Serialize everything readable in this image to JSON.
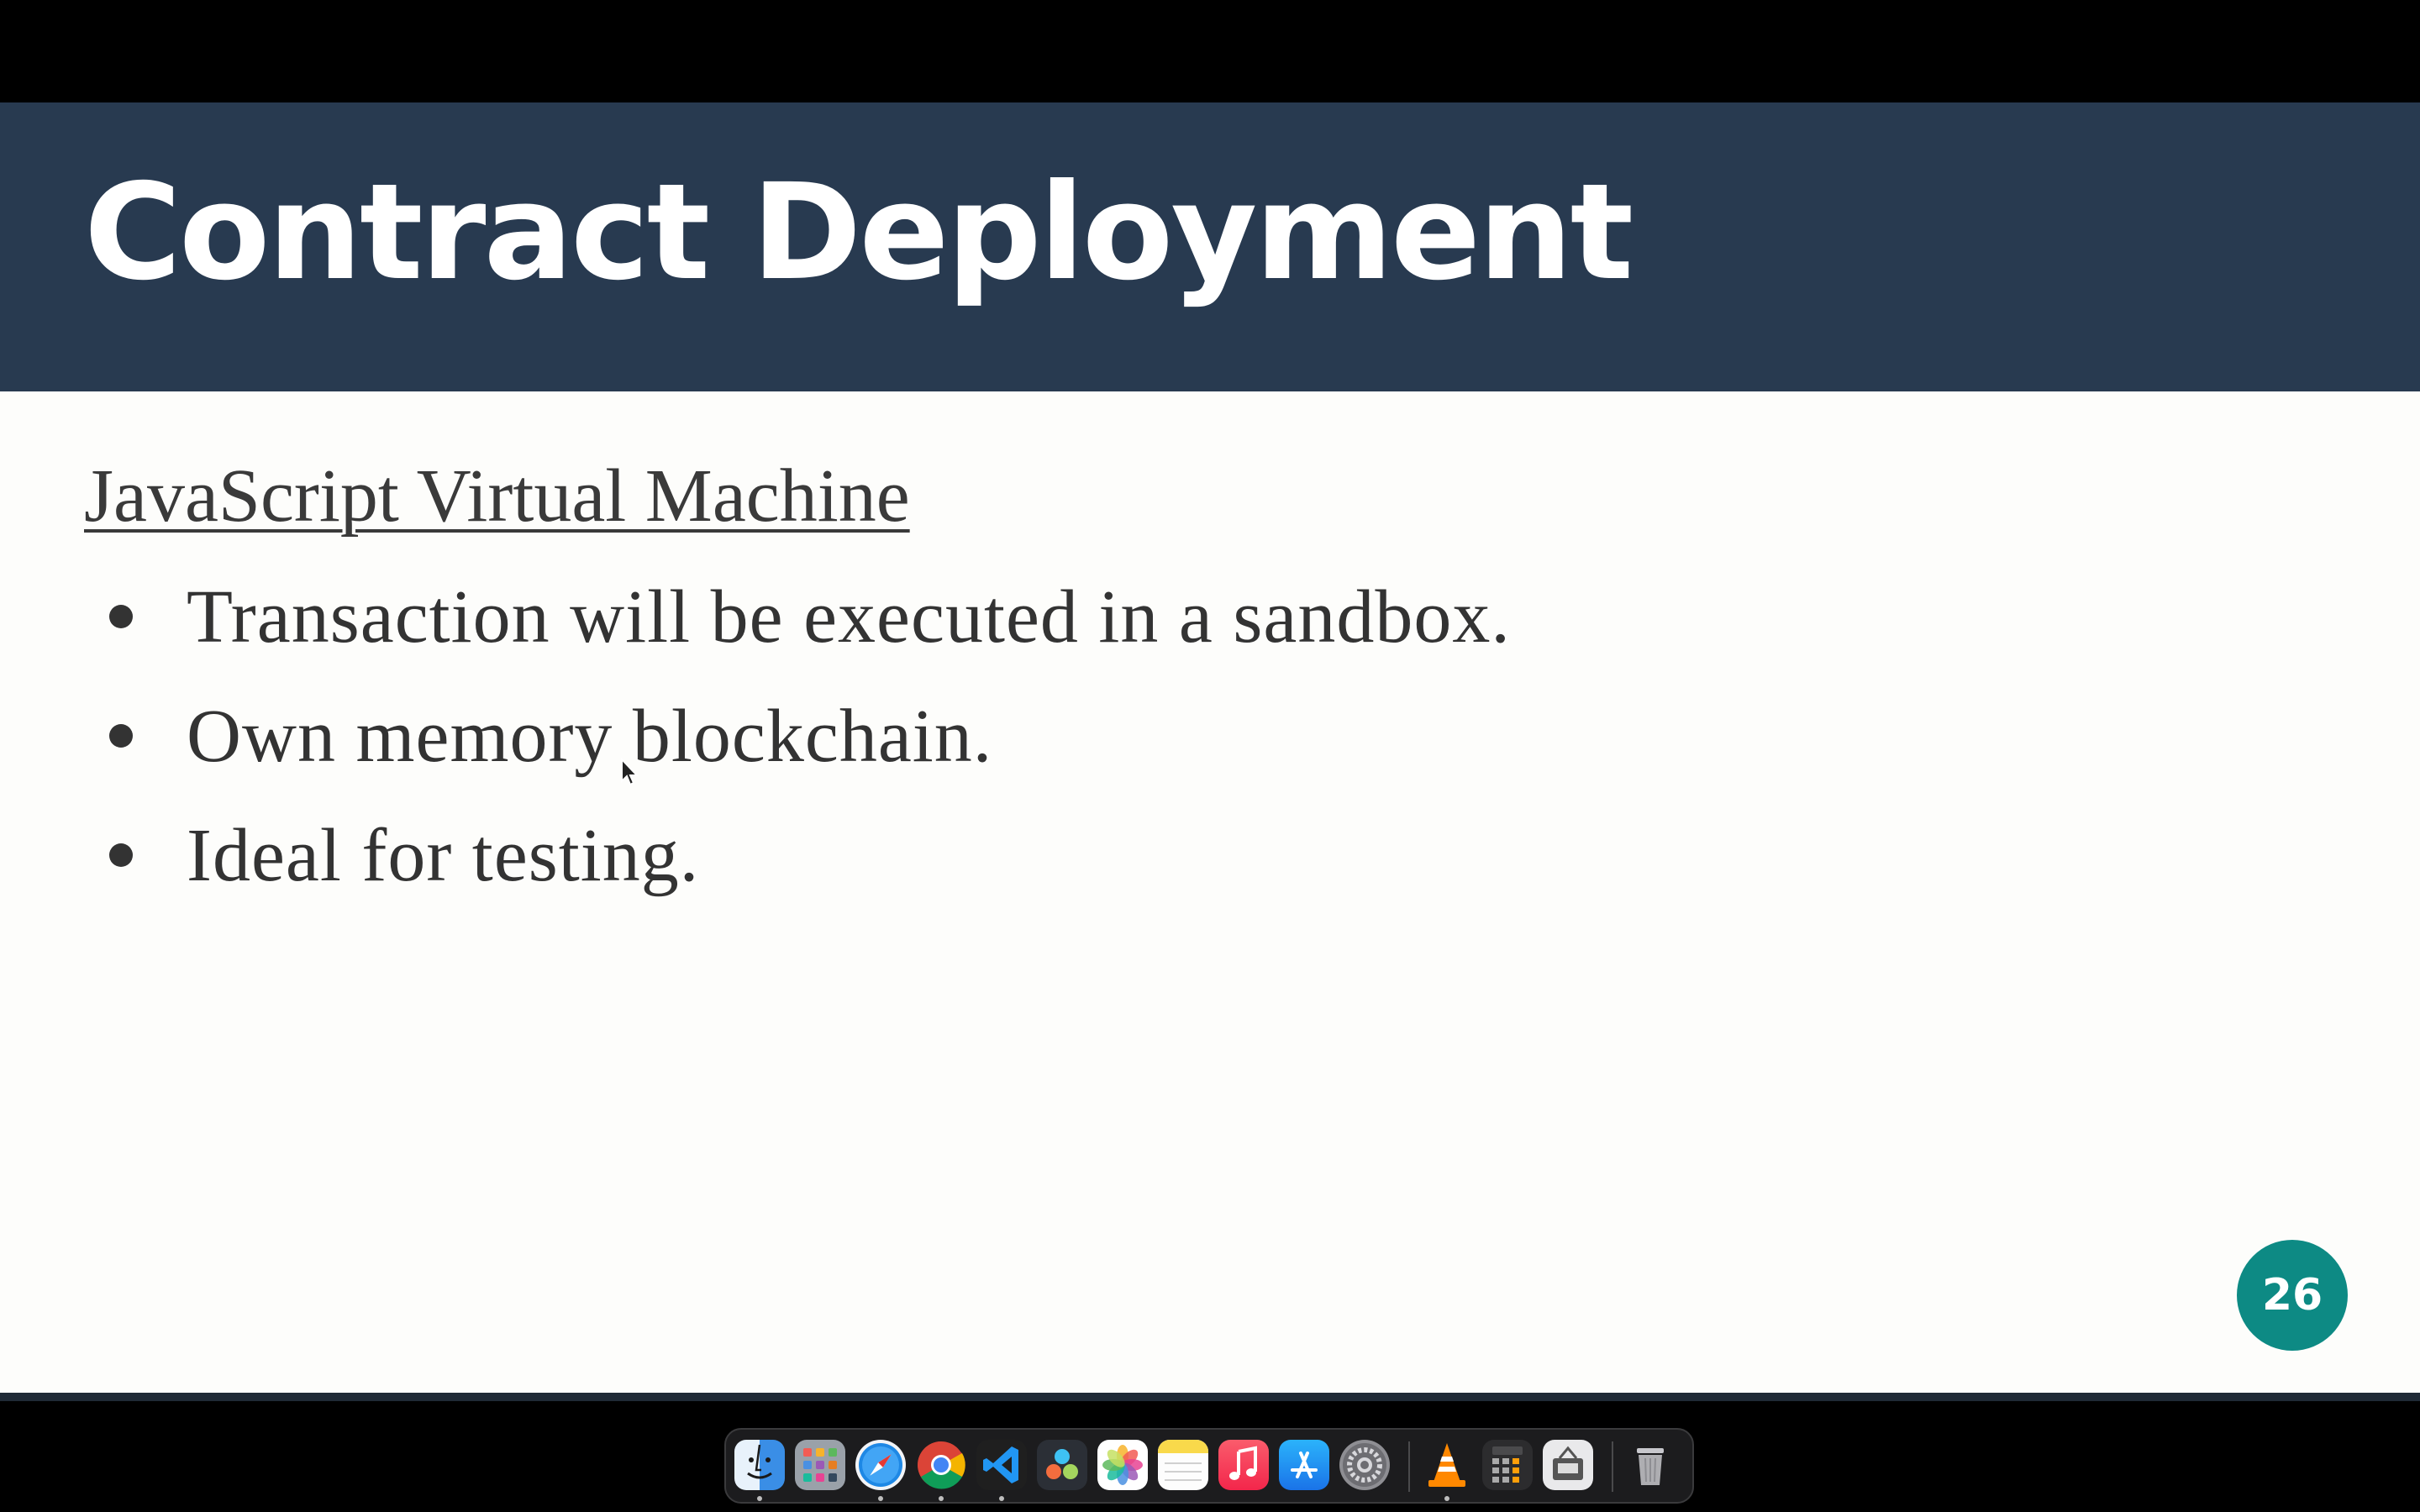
{
  "slide": {
    "title": "Contract Deployment",
    "subheading": "JavaScript Virtual Machine",
    "bullets": [
      "Transaction will be executed in a sandbox.",
      "Own memory blockchain.",
      "Ideal for testing."
    ],
    "page_number": "26"
  },
  "colors": {
    "title_bar": "#283a50",
    "slide_bg": "#fdfdfb",
    "page_badge": "#0d8a84",
    "dock_bg": "#1c1c1e"
  },
  "dock": {
    "apps": [
      {
        "name": "finder-icon",
        "running": true
      },
      {
        "name": "launchpad-icon",
        "running": false
      },
      {
        "name": "safari-icon",
        "running": true
      },
      {
        "name": "chrome-icon",
        "running": true
      },
      {
        "name": "vscode-icon",
        "running": true
      },
      {
        "name": "davinci-resolve-icon",
        "running": false
      },
      {
        "name": "photos-icon",
        "running": false
      },
      {
        "name": "notes-icon",
        "running": false
      },
      {
        "name": "music-icon",
        "running": false
      },
      {
        "name": "app-store-icon",
        "running": false
      },
      {
        "name": "system-settings-icon",
        "running": false
      },
      {
        "name": "vlc-icon",
        "running": true
      },
      {
        "name": "calculator-icon",
        "running": false
      },
      {
        "name": "app-icon",
        "running": false
      },
      {
        "name": "trash-icon",
        "running": false
      }
    ]
  }
}
